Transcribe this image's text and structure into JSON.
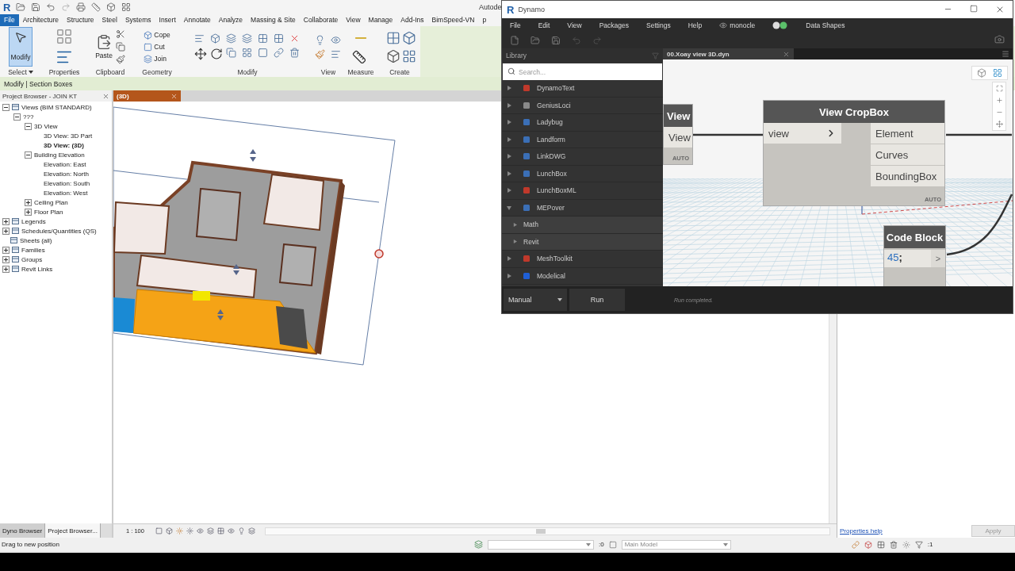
{
  "revit": {
    "logo": "R",
    "app_title": "Autode",
    "ribbon_tabs": [
      {
        "label": "File",
        "selected": true
      },
      {
        "label": "Architecture",
        "selected": false
      },
      {
        "label": "Structure",
        "selected": false
      },
      {
        "label": "Steel",
        "selected": false
      },
      {
        "label": "Systems",
        "selected": false
      },
      {
        "label": "Insert",
        "selected": false
      },
      {
        "label": "Annotate",
        "selected": false
      },
      {
        "label": "Analyze",
        "selected": false
      },
      {
        "label": "Massing & Site",
        "selected": false
      },
      {
        "label": "Collaborate",
        "selected": false
      },
      {
        "label": "View",
        "selected": false
      },
      {
        "label": "Manage",
        "selected": false
      },
      {
        "label": "Add-Ins",
        "selected": false
      },
      {
        "label": "BimSpeed-VN",
        "selected": false
      },
      {
        "label": "p",
        "selected": false
      }
    ],
    "ribbon": {
      "modify": {
        "label": "Modify",
        "selected": true
      },
      "paste": "Paste",
      "cope": "Cope",
      "cut": "Cut",
      "join": "Join",
      "panels": [
        {
          "label": "Select",
          "dropdown": true
        },
        {
          "label": "Properties"
        },
        {
          "label": "Clipboard"
        },
        {
          "label": "Geometry"
        },
        {
          "label": "Modify"
        },
        {
          "label": "View"
        },
        {
          "label": "Measure"
        },
        {
          "label": "Create"
        }
      ]
    },
    "context_bar": "Modify | Section Boxes",
    "project_browser": {
      "title": "Project Browser - JOIN KT",
      "tree": [
        {
          "label": "Views (BIM STANDARD)",
          "expanded": true,
          "selected": false,
          "children": [
            {
              "label": "???",
              "expanded": true,
              "selected": false,
              "children": [
                {
                  "label": "3D View",
                  "expanded": true,
                  "selected": false,
                  "children": [
                    {
                      "label": "3D View: 3D Part",
                      "selected": false
                    },
                    {
                      "label": "3D View: (3D)",
                      "selected": true
                    }
                  ]
                },
                {
                  "label": "Building Elevation",
                  "expanded": true,
                  "selected": false,
                  "children": [
                    {
                      "label": "Elevation: East",
                      "selected": false
                    },
                    {
                      "label": "Elevation: North",
                      "selected": false
                    },
                    {
                      "label": "Elevation: South",
                      "selected": false
                    },
                    {
                      "label": "Elevation: West",
                      "selected": false
                    }
                  ]
                },
                {
                  "label": "Ceiling Plan",
                  "expanded": false,
                  "selected": false
                },
                {
                  "label": "Floor Plan",
                  "expanded": false,
                  "selected": false
                }
              ]
            }
          ]
        },
        {
          "label": "Legends",
          "expanded": false,
          "selected": false
        },
        {
          "label": "Schedules/Quantities (QS)",
          "expanded": false,
          "selected": false
        },
        {
          "label": "Sheets (all)",
          "selected": false
        },
        {
          "label": "Families",
          "expanded": false,
          "selected": false
        },
        {
          "label": "Groups",
          "expanded": false,
          "selected": false
        },
        {
          "label": "Revit Links",
          "expanded": false,
          "selected": false
        }
      ]
    },
    "view_tab": "(3D)",
    "view_scale": "1 : 100",
    "browser_tabs": [
      {
        "label": "Dyno Browser",
        "selected": false
      },
      {
        "label": "Project Browser...",
        "selected": true
      }
    ],
    "properties": {
      "help_link": "Properties help",
      "apply": {
        "label": "Apply",
        "disabled": true
      }
    },
    "status": {
      "message": "Drag to new position",
      "editable_count": ":0",
      "model": "Main Model",
      "filter_count": ":1"
    }
  },
  "dynamo": {
    "logo": "R",
    "title": "Dynamo",
    "menu": [
      {
        "label": "File",
        "kind": "plain"
      },
      {
        "label": "Edit",
        "kind": "plain"
      },
      {
        "label": "View",
        "kind": "plain"
      },
      {
        "label": "Packages",
        "kind": "plain"
      },
      {
        "label": "Settings",
        "kind": "plain"
      },
      {
        "label": "Help",
        "kind": "plain"
      },
      {
        "label": "monocle",
        "kind": "plugin"
      },
      {
        "label": "Data Shapes",
        "kind": "plain"
      }
    ],
    "library": {
      "title": "Library",
      "search_placeholder": "Search...",
      "items": [
        {
          "label": "DynamoText",
          "expanded": false,
          "color": "#c0392b"
        },
        {
          "label": "GeniusLoci",
          "expanded": false,
          "color": "#8a8a8a"
        },
        {
          "label": "Ladybug",
          "expanded": false,
          "color": "#3b6fb6"
        },
        {
          "label": "Landform",
          "expanded": false,
          "color": "#3b6fb6"
        },
        {
          "label": "LinkDWG",
          "expanded": false,
          "color": "#3b6fb6"
        },
        {
          "label": "LunchBox",
          "expanded": false,
          "color": "#3b6fb6"
        },
        {
          "label": "LunchBoxML",
          "expanded": false,
          "color": "#c0392b"
        },
        {
          "label": "MEPover",
          "expanded": true,
          "color": "#3b6fb6",
          "children": [
            {
              "label": "Math",
              "expanded": false
            },
            {
              "label": "Revit",
              "expanded": false
            }
          ]
        },
        {
          "label": "MeshToolkit",
          "expanded": false,
          "color": "#c0392b"
        },
        {
          "label": "Modelical",
          "expanded": false,
          "color": "#1f5fd6"
        }
      ]
    },
    "tab": "00.Xoay view 3D.dyn",
    "nodes": [
      {
        "kind": "partial",
        "title": "View",
        "outputs": [
          "View"
        ],
        "lacing": "AUTO"
      },
      {
        "kind": "node",
        "title": "View CropBox",
        "inputs": [
          "view"
        ],
        "outputs": [
          "Element",
          "Curves",
          "BoundingBox"
        ],
        "lacing": "AUTO"
      },
      {
        "kind": "code",
        "title": "Code Block",
        "code": [
          {
            "text": "45",
            "kind": "number"
          },
          {
            "text": ";",
            "kind": "punctuation"
          }
        ],
        "output": ">"
      }
    ],
    "run_mode": "Manual",
    "run": "Run",
    "status": "Run completed."
  }
}
